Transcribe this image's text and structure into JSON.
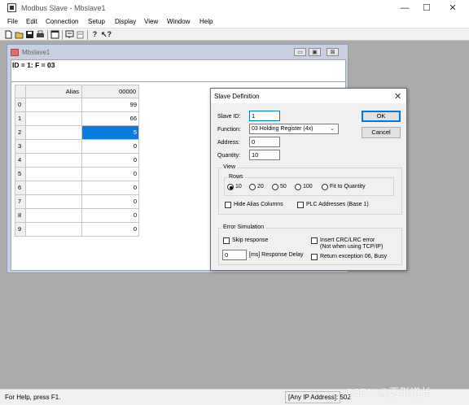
{
  "window": {
    "title": "Modbus Slave - Mbslave1",
    "minimize": "—",
    "maximize": "☐",
    "close": "✕"
  },
  "menu": [
    "File",
    "Edit",
    "Connection",
    "Setup",
    "Display",
    "View",
    "Window",
    "Help"
  ],
  "toolbar": {
    "icons": [
      "new-icon",
      "open-icon",
      "save-icon",
      "print-icon",
      "window-icon",
      "display-icon",
      "unknown-icon",
      "help-icon",
      "context-help-icon"
    ]
  },
  "child_window": {
    "title": "Mbslave1",
    "id_line": "ID = 1: F = 03",
    "btn_min": "▭",
    "btn_restore": "▣",
    "btn_close": "⊠",
    "grid": {
      "alias_header": "Alias",
      "col_header": "00000",
      "rows": [
        {
          "index": "0",
          "value": "99"
        },
        {
          "index": "1",
          "value": "66"
        },
        {
          "index": "2",
          "value": "5"
        },
        {
          "index": "3",
          "value": "0"
        },
        {
          "index": "4",
          "value": "0"
        },
        {
          "index": "5",
          "value": "0"
        },
        {
          "index": "6",
          "value": "0"
        },
        {
          "index": "7",
          "value": "0"
        },
        {
          "index": "8",
          "value": "0"
        },
        {
          "index": "9",
          "value": "0"
        }
      ]
    }
  },
  "dialog": {
    "title": "Slave Definition",
    "close": "✕",
    "slave_id_label": "Slave ID:",
    "slave_id_value": "1",
    "function_label": "Function:",
    "function_value": "03 Holding Register (4x)",
    "address_label": "Address:",
    "address_value": "0",
    "quantity_label": "Quantity:",
    "quantity_value": "10",
    "ok_label": "OK",
    "cancel_label": "Cancel",
    "view_group": "View",
    "rows_group": "Rows",
    "rows_options": [
      {
        "label": "10",
        "selected": true
      },
      {
        "label": "20",
        "selected": false
      },
      {
        "label": "50",
        "selected": false
      },
      {
        "label": "100",
        "selected": false
      },
      {
        "label": "Fit to Quantity",
        "selected": false
      }
    ],
    "hide_alias_label": "Hide Alias Columns",
    "plc_addresses_label": "PLC Addresses (Base 1)",
    "error_group": "Error Simulation",
    "skip_response_label": "Skip response",
    "insert_crc_label": "Insert CRC/LRC error",
    "insert_crc_note": "(Not when using TCP/IP)",
    "delay_value": "0",
    "delay_label": "[ms] Response Delay",
    "return_exception_label": "Return exception 06, Busy"
  },
  "status": {
    "help_text": "For Help, press F1.",
    "address_text": "[Any IP Address]: 502"
  },
  "watermark": "CSDN @无形道长",
  "colors": {
    "selection": "#0a7be0",
    "mdi_background": "#ababab",
    "ok_border": "#0078d7"
  }
}
